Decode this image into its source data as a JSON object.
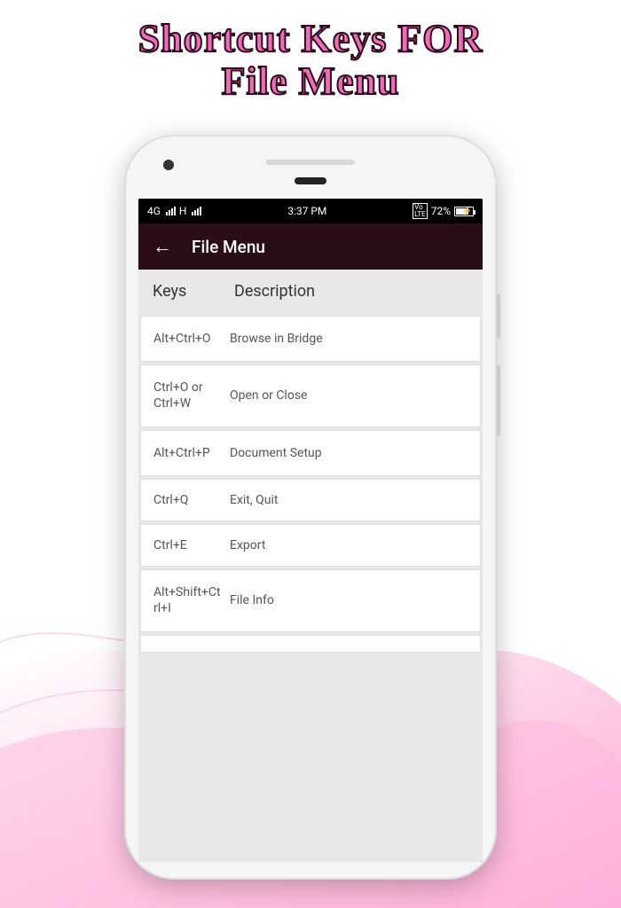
{
  "promo": {
    "line1": "Shortcut Keys FOR",
    "line2": "File Menu"
  },
  "status": {
    "network": "4G",
    "extra": "H",
    "time": "3:37 PM",
    "lte": "VoLTE",
    "battery_pct": "72%"
  },
  "appbar": {
    "title": "File Menu"
  },
  "headers": {
    "keys": "Keys",
    "desc": "Description"
  },
  "rows": [
    {
      "key": "Alt+Ctrl+O",
      "desc": "Browse in Bridge"
    },
    {
      "key": "Ctrl+O or Ctrl+W",
      "desc": "Open or Close"
    },
    {
      "key": "Alt+Ctrl+P",
      "desc": "Document Setup"
    },
    {
      "key": "Ctrl+Q",
      "desc": "Exit, Quit"
    },
    {
      "key": "Ctrl+E",
      "desc": "Export"
    },
    {
      "key": "Alt+Shift+Ctrl+I",
      "desc": "File Info"
    }
  ]
}
